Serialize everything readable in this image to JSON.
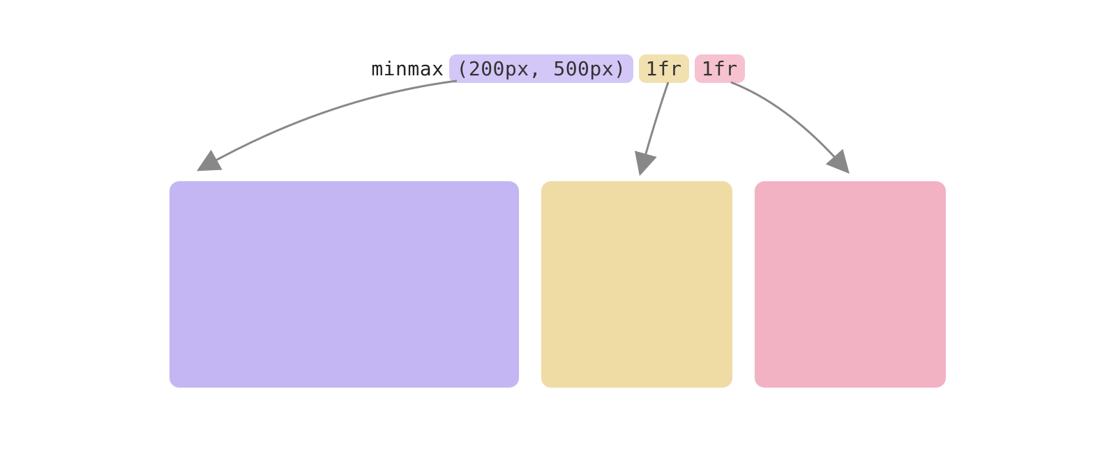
{
  "code": {
    "prefix": "minmax",
    "token1": "(200px, 500px)",
    "token2": "1fr",
    "token3": "1fr"
  },
  "colors": {
    "purple_light": "#d3c7f7",
    "yellow_light": "#f2e1b0",
    "pink_light": "#f6c2d0",
    "purple_box": "#c4b6f3",
    "yellow_box": "#efdba4",
    "pink_box": "#f3b1c4",
    "arrow": "#888888"
  },
  "layout_note": "Diagram showing CSS grid-template-columns: minmax(200px, 500px) 1fr 1fr mapping to three grid columns"
}
